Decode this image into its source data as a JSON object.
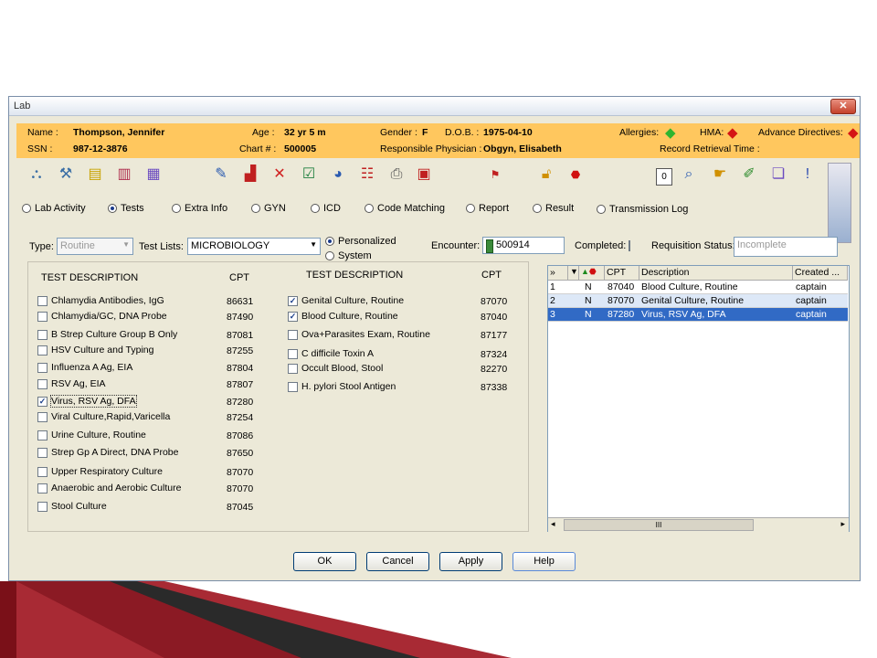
{
  "window": {
    "title": "Lab",
    "close_label": "✕"
  },
  "patient": {
    "name_label": "Name :",
    "name": "Thompson, Jennifer",
    "age_label": "Age :",
    "age": "32 yr 5 m",
    "gender_label": "Gender :",
    "gender": "F",
    "dob_label": "D.O.B. :",
    "dob": "1975-04-10",
    "allergies_label": "Allergies:",
    "hma_label": "HMA:",
    "advance_label": "Advance Directives:",
    "ssn_label": "SSN :",
    "ssn": "987-12-3876",
    "chart_label": "Chart # :",
    "chart": "500005",
    "physician_label": "Responsible Physician :",
    "physician": "Obgyn, Elisabeth",
    "retrieval_label": "Record Retrieval Time :"
  },
  "toolbar": {
    "counter": "0"
  },
  "tabs": [
    {
      "label": "Lab Activity",
      "selected": false
    },
    {
      "label": "Tests",
      "selected": true
    },
    {
      "label": "Extra Info",
      "selected": false
    },
    {
      "label": "GYN",
      "selected": false
    },
    {
      "label": "ICD",
      "selected": false
    },
    {
      "label": "Code Matching",
      "selected": false
    },
    {
      "label": "Report",
      "selected": false
    },
    {
      "label": "Result",
      "selected": false
    },
    {
      "label": "Transmission Log",
      "selected": false
    }
  ],
  "filters": {
    "type_label": "Type:",
    "type_value": "Routine",
    "testlists_label": "Test Lists:",
    "testlists_value": "MICROBIOLOGY",
    "personalized": "Personalized",
    "system": "System",
    "encounter_label": "Encounter:",
    "encounter_value": "500914",
    "completed_label": "Completed:",
    "req_status_label": "Requisition Status:",
    "req_status_value": "Incomplete"
  },
  "tests_panel": {
    "col_desc": "TEST DESCRIPTION",
    "col_cpt": "CPT",
    "left": [
      {
        "desc": "Chlamydia Antibodies, IgG",
        "cpt": "86631",
        "checked": false
      },
      {
        "desc": "Chlamydia/GC, DNA Probe",
        "cpt": "87490",
        "checked": false
      },
      {
        "desc": "B Strep Culture Group B Only",
        "cpt": "87081",
        "checked": false
      },
      {
        "desc": "HSV Culture and Typing",
        "cpt": "87255",
        "checked": false
      },
      {
        "desc": "Influenza A Ag, EIA",
        "cpt": "87804",
        "checked": false
      },
      {
        "desc": "RSV Ag, EIA",
        "cpt": "87807",
        "checked": false
      },
      {
        "desc": "Virus, RSV Ag, DFA",
        "cpt": "87280",
        "checked": true
      },
      {
        "desc": "Viral Culture,Rapid,Varicella",
        "cpt": "87254",
        "checked": false
      },
      {
        "desc": "Urine Culture, Routine",
        "cpt": "87086",
        "checked": false
      },
      {
        "desc": "Strep Gp A Direct, DNA Probe",
        "cpt": "87650",
        "checked": false
      },
      {
        "desc": "Upper Respiratory Culture",
        "cpt": "87070",
        "checked": false
      },
      {
        "desc": "Anaerobic and Aerobic Culture",
        "cpt": "87070",
        "checked": false
      },
      {
        "desc": "Stool Culture",
        "cpt": "87045",
        "checked": false
      }
    ],
    "right": [
      {
        "desc": "Genital Culture, Routine",
        "cpt": "87070",
        "checked": true
      },
      {
        "desc": "Blood Culture, Routine",
        "cpt": "87040",
        "checked": true
      },
      {
        "desc": "Ova+Parasites Exam, Routine",
        "cpt": "87177",
        "checked": false
      },
      {
        "desc": "C difficile Toxin A",
        "cpt": "87324",
        "checked": false
      },
      {
        "desc": "Occult Blood, Stool",
        "cpt": "82270",
        "checked": false
      },
      {
        "desc": "H. pylori Stool Antigen",
        "cpt": "87338",
        "checked": false
      }
    ]
  },
  "orders_grid": {
    "headers": {
      "expand": "»",
      "cpt": "CPT",
      "desc": "Description",
      "created": "Created ..."
    },
    "rows": [
      {
        "num": "1",
        "n": "N",
        "cpt": "87040",
        "desc": "Blood Culture, Routine",
        "created": "captain"
      },
      {
        "num": "2",
        "n": "N",
        "cpt": "87070",
        "desc": "Genital Culture, Routine",
        "created": "captain"
      },
      {
        "num": "3",
        "n": "N",
        "cpt": "87280",
        "desc": "Virus, RSV Ag, DFA",
        "created": "captain"
      }
    ],
    "scroll_mark": "III"
  },
  "buttons": {
    "ok": "OK",
    "cancel": "Cancel",
    "apply": "Apply",
    "help": "Help"
  },
  "colors": {
    "patient_bar": "#ffc75e",
    "selection": "#316ac5",
    "accent_red": "#8b1a1a"
  }
}
